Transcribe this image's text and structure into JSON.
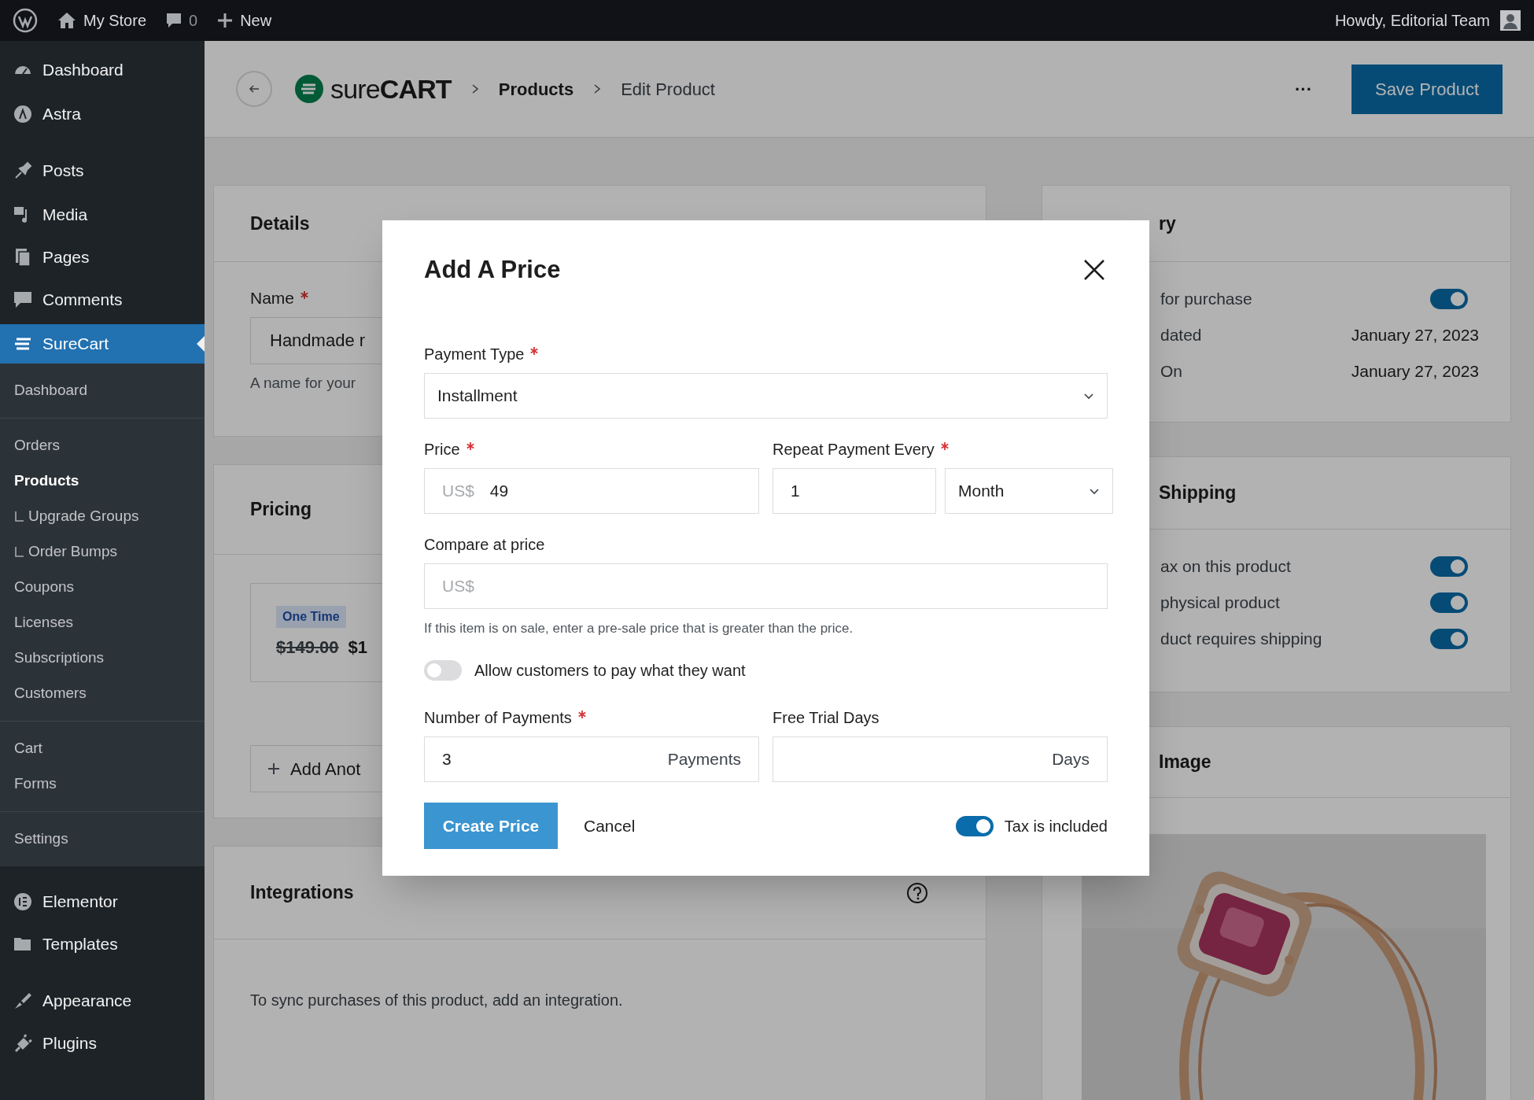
{
  "admin_bar": {
    "site": "My Store",
    "comments": "0",
    "new": "New",
    "greeting": "Howdy, Editorial Team"
  },
  "sidebar": {
    "menu_top": [
      {
        "label": "Dashboard",
        "selected": false
      },
      {
        "label": "Astra",
        "selected": false
      },
      {
        "label": "Posts",
        "selected": false
      },
      {
        "label": "Media",
        "selected": false
      },
      {
        "label": "Pages",
        "selected": false
      },
      {
        "label": "Comments",
        "selected": false
      },
      {
        "label": "SureCart",
        "selected": true
      }
    ],
    "submenu": [
      {
        "items": [
          {
            "label": "Dashboard",
            "selected": false
          }
        ]
      },
      {
        "items": [
          {
            "label": "Orders",
            "selected": false
          },
          {
            "label": "Products",
            "selected": true,
            "children": [
              {
                "label": "Upgrade Groups",
                "selected": false
              },
              {
                "label": "Order Bumps",
                "selected": false
              }
            ]
          },
          {
            "label": "Coupons",
            "selected": false
          },
          {
            "label": "Licenses",
            "selected": false
          },
          {
            "label": "Subscriptions",
            "selected": false
          },
          {
            "label": "Customers",
            "selected": false
          }
        ]
      },
      {
        "items": [
          {
            "label": "Cart",
            "selected": false
          },
          {
            "label": "Forms",
            "selected": false
          }
        ]
      },
      {
        "items": [
          {
            "label": "Settings",
            "selected": false
          }
        ]
      }
    ],
    "menu_bottom": [
      {
        "label": "Elementor",
        "selected": false
      },
      {
        "label": "Templates",
        "selected": false
      },
      {
        "label": "Appearance",
        "selected": false
      },
      {
        "label": "Plugins",
        "selected": false
      }
    ]
  },
  "header": {
    "brand": "sure**CART**",
    "breadcrumbs": [
      "Products",
      "Edit Product"
    ],
    "more": "···",
    "save_button": "Save Product"
  },
  "details": {
    "title": "Details",
    "name_label": "Name",
    "required": true,
    "name_value": "Handmade r",
    "help": "A name for your"
  },
  "pricing": {
    "title": "Pricing",
    "badge": "One Time",
    "original_price": "$149.00",
    "price": "$1",
    "add_button": "Add Anot"
  },
  "integrations": {
    "title": "Integrations",
    "text": "To sync purchases of this product, add an integration."
  },
  "summary": {
    "title": "ry",
    "rows": [
      {
        "kind": "toggle",
        "label": "for purchase",
        "on": true
      },
      {
        "kind": "value",
        "label": "dated",
        "value": "January 27, 2023"
      },
      {
        "kind": "value",
        "label": "On",
        "value": "January 27, 2023"
      }
    ]
  },
  "shipping": {
    "title": "Shipping",
    "rows": [
      {
        "kind": "toggle",
        "label": "ax on this product",
        "on": true
      },
      {
        "kind": "toggle",
        "label": "physical product",
        "on": true
      },
      {
        "kind": "toggle",
        "label": "duct requires shipping",
        "on": true
      }
    ]
  },
  "image": {
    "title": "Image",
    "kind": "picture"
  },
  "modal": {
    "title": "Add A Price",
    "payment_type": {
      "label": "Payment Type",
      "required": true,
      "value": "Installment"
    },
    "price": {
      "label": "Price",
      "required": true,
      "prefix": "US$",
      "value": "49"
    },
    "repeat": {
      "label": "Repeat Payment Every",
      "required": true,
      "value": "1",
      "unit": "Month"
    },
    "compare": {
      "label": "Compare at price",
      "required": false,
      "prefix": "US$",
      "help": "If this item is on sale, enter a pre-sale price that is greater than the price."
    },
    "pay_what_you_want": {
      "label": "Allow customers to pay what they want",
      "on": false
    },
    "payments": {
      "label": "Number of Payments",
      "required": true,
      "value": "3",
      "suffix": "Payments"
    },
    "trial": {
      "label": "Free Trial Days",
      "required": false,
      "suffix": "Days"
    },
    "create_button": "Create Price",
    "cancel_button": "Cancel",
    "tax_included": {
      "label": "Tax is included",
      "on": true
    }
  }
}
